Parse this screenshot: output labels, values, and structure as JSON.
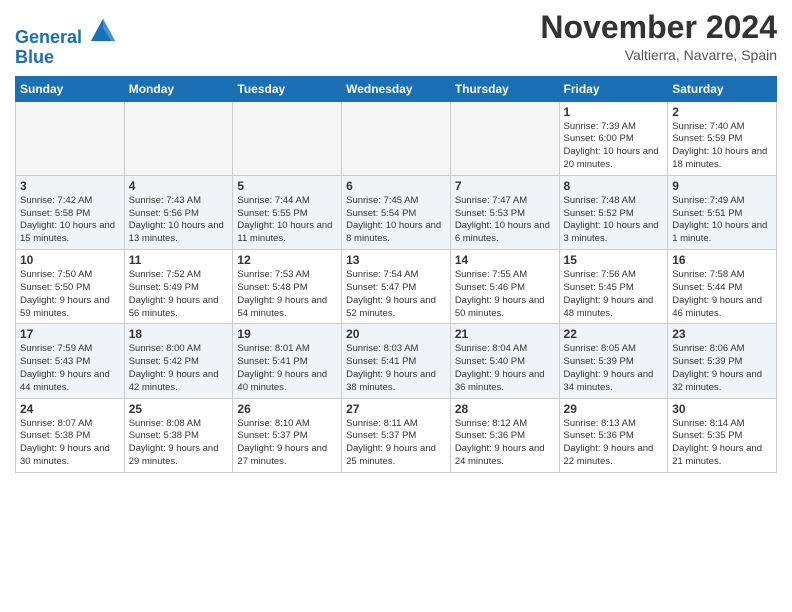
{
  "header": {
    "logo_line1": "General",
    "logo_line2": "Blue",
    "month": "November 2024",
    "location": "Valtierra, Navarre, Spain"
  },
  "weekdays": [
    "Sunday",
    "Monday",
    "Tuesday",
    "Wednesday",
    "Thursday",
    "Friday",
    "Saturday"
  ],
  "weeks": [
    [
      {
        "day": "",
        "info": ""
      },
      {
        "day": "",
        "info": ""
      },
      {
        "day": "",
        "info": ""
      },
      {
        "day": "",
        "info": ""
      },
      {
        "day": "",
        "info": ""
      },
      {
        "day": "1",
        "info": "Sunrise: 7:39 AM\nSunset: 6:00 PM\nDaylight: 10 hours and 20 minutes."
      },
      {
        "day": "2",
        "info": "Sunrise: 7:40 AM\nSunset: 5:59 PM\nDaylight: 10 hours and 18 minutes."
      }
    ],
    [
      {
        "day": "3",
        "info": "Sunrise: 7:42 AM\nSunset: 5:58 PM\nDaylight: 10 hours and 15 minutes."
      },
      {
        "day": "4",
        "info": "Sunrise: 7:43 AM\nSunset: 5:56 PM\nDaylight: 10 hours and 13 minutes."
      },
      {
        "day": "5",
        "info": "Sunrise: 7:44 AM\nSunset: 5:55 PM\nDaylight: 10 hours and 11 minutes."
      },
      {
        "day": "6",
        "info": "Sunrise: 7:45 AM\nSunset: 5:54 PM\nDaylight: 10 hours and 8 minutes."
      },
      {
        "day": "7",
        "info": "Sunrise: 7:47 AM\nSunset: 5:53 PM\nDaylight: 10 hours and 6 minutes."
      },
      {
        "day": "8",
        "info": "Sunrise: 7:48 AM\nSunset: 5:52 PM\nDaylight: 10 hours and 3 minutes."
      },
      {
        "day": "9",
        "info": "Sunrise: 7:49 AM\nSunset: 5:51 PM\nDaylight: 10 hours and 1 minute."
      }
    ],
    [
      {
        "day": "10",
        "info": "Sunrise: 7:50 AM\nSunset: 5:50 PM\nDaylight: 9 hours and 59 minutes."
      },
      {
        "day": "11",
        "info": "Sunrise: 7:52 AM\nSunset: 5:49 PM\nDaylight: 9 hours and 56 minutes."
      },
      {
        "day": "12",
        "info": "Sunrise: 7:53 AM\nSunset: 5:48 PM\nDaylight: 9 hours and 54 minutes."
      },
      {
        "day": "13",
        "info": "Sunrise: 7:54 AM\nSunset: 5:47 PM\nDaylight: 9 hours and 52 minutes."
      },
      {
        "day": "14",
        "info": "Sunrise: 7:55 AM\nSunset: 5:46 PM\nDaylight: 9 hours and 50 minutes."
      },
      {
        "day": "15",
        "info": "Sunrise: 7:56 AM\nSunset: 5:45 PM\nDaylight: 9 hours and 48 minutes."
      },
      {
        "day": "16",
        "info": "Sunrise: 7:58 AM\nSunset: 5:44 PM\nDaylight: 9 hours and 46 minutes."
      }
    ],
    [
      {
        "day": "17",
        "info": "Sunrise: 7:59 AM\nSunset: 5:43 PM\nDaylight: 9 hours and 44 minutes."
      },
      {
        "day": "18",
        "info": "Sunrise: 8:00 AM\nSunset: 5:42 PM\nDaylight: 9 hours and 42 minutes."
      },
      {
        "day": "19",
        "info": "Sunrise: 8:01 AM\nSunset: 5:41 PM\nDaylight: 9 hours and 40 minutes."
      },
      {
        "day": "20",
        "info": "Sunrise: 8:03 AM\nSunset: 5:41 PM\nDaylight: 9 hours and 38 minutes."
      },
      {
        "day": "21",
        "info": "Sunrise: 8:04 AM\nSunset: 5:40 PM\nDaylight: 9 hours and 36 minutes."
      },
      {
        "day": "22",
        "info": "Sunrise: 8:05 AM\nSunset: 5:39 PM\nDaylight: 9 hours and 34 minutes."
      },
      {
        "day": "23",
        "info": "Sunrise: 8:06 AM\nSunset: 5:39 PM\nDaylight: 9 hours and 32 minutes."
      }
    ],
    [
      {
        "day": "24",
        "info": "Sunrise: 8:07 AM\nSunset: 5:38 PM\nDaylight: 9 hours and 30 minutes."
      },
      {
        "day": "25",
        "info": "Sunrise: 8:08 AM\nSunset: 5:38 PM\nDaylight: 9 hours and 29 minutes."
      },
      {
        "day": "26",
        "info": "Sunrise: 8:10 AM\nSunset: 5:37 PM\nDaylight: 9 hours and 27 minutes."
      },
      {
        "day": "27",
        "info": "Sunrise: 8:11 AM\nSunset: 5:37 PM\nDaylight: 9 hours and 25 minutes."
      },
      {
        "day": "28",
        "info": "Sunrise: 8:12 AM\nSunset: 5:36 PM\nDaylight: 9 hours and 24 minutes."
      },
      {
        "day": "29",
        "info": "Sunrise: 8:13 AM\nSunset: 5:36 PM\nDaylight: 9 hours and 22 minutes."
      },
      {
        "day": "30",
        "info": "Sunrise: 8:14 AM\nSunset: 5:35 PM\nDaylight: 9 hours and 21 minutes."
      }
    ]
  ]
}
